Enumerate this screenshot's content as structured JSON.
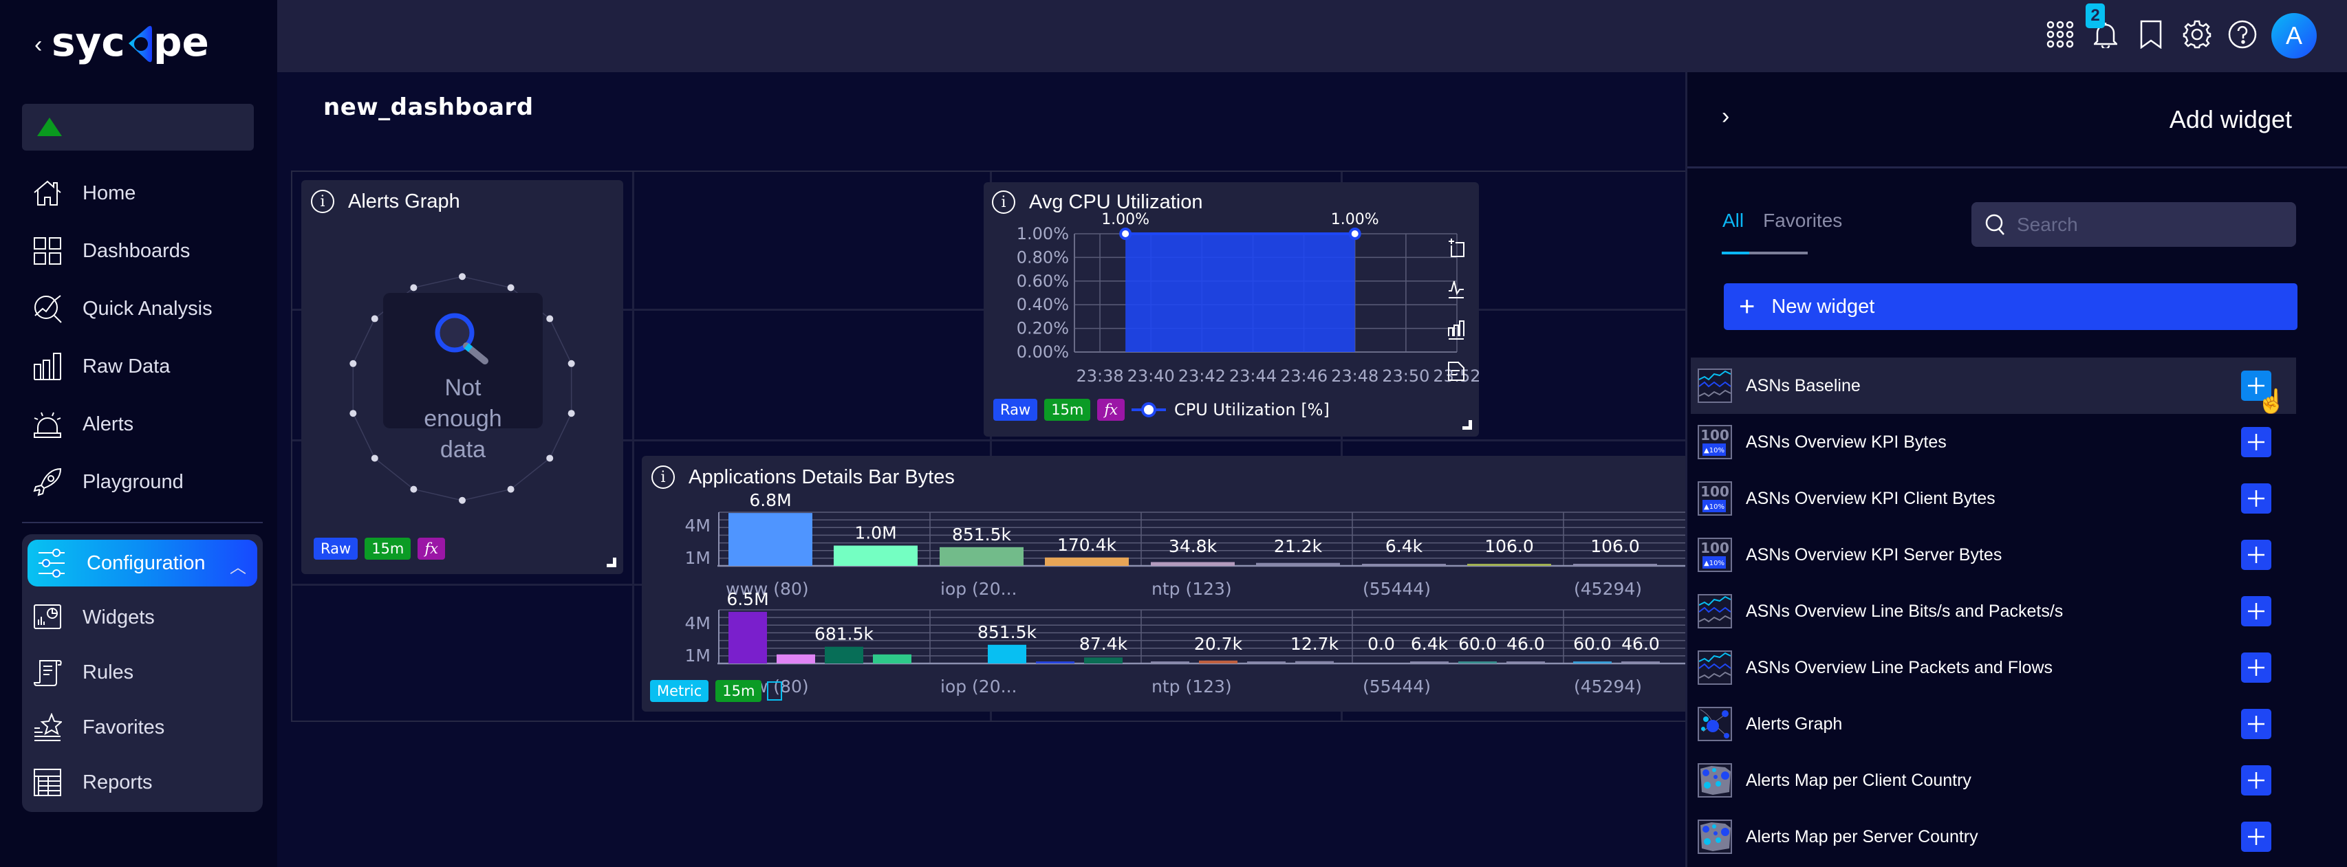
{
  "app": {
    "brand": "sycope",
    "back_icon": "chevron-left-icon"
  },
  "sidebar": {
    "status_icon": "green-triangle-icon",
    "items": [
      {
        "label": "Home",
        "icon": "home-icon"
      },
      {
        "label": "Dashboards",
        "icon": "dashboards-icon"
      },
      {
        "label": "Quick Analysis",
        "icon": "quick-analysis-icon"
      },
      {
        "label": "Raw Data",
        "icon": "bar-chart-icon"
      },
      {
        "label": "Alerts",
        "icon": "siren-icon"
      },
      {
        "label": "Playground",
        "icon": "rocket-icon"
      }
    ],
    "configuration": {
      "label": "Configuration",
      "icon": "sliders-icon",
      "expanded": true,
      "children": [
        {
          "label": "Widgets",
          "icon": "widgets-icon"
        },
        {
          "label": "Rules",
          "icon": "scroll-icon"
        },
        {
          "label": "Favorites",
          "icon": "star-list-icon"
        },
        {
          "label": "Reports",
          "icon": "table-icon"
        }
      ]
    }
  },
  "topbar": {
    "icons": [
      "apps-grid-icon",
      "bell-icon",
      "bookmark-icon",
      "gear-icon",
      "help-icon"
    ],
    "notification_count": "2",
    "avatar_initial": "A"
  },
  "dashboard": {
    "title": "new_dashboard",
    "widgets": {
      "alerts_graph": {
        "title": "Alerts Graph",
        "empty_message": "Not enough data",
        "tags": [
          "Raw",
          "15m",
          "fx"
        ]
      },
      "avg_cpu": {
        "title": "Avg CPU Utilization",
        "tags": [
          "Raw",
          "15m",
          "fx"
        ],
        "legend": "CPU Utilization [%]",
        "toolbar_icons": [
          "zoom-select-icon",
          "line-chart-icon",
          "bar-chart-icon",
          "export-icon"
        ]
      },
      "app_bar": {
        "title": "Applications Details Bar Bytes",
        "tags": [
          "Metric",
          "15m"
        ]
      }
    }
  },
  "chart_data": [
    {
      "type": "area",
      "title": "Avg CPU Utilization",
      "x": [
        "23:38",
        "23:40",
        "23:42",
        "23:44",
        "23:46",
        "23:48",
        "23:50",
        "23:52"
      ],
      "series": [
        {
          "name": "CPU Utilization [%]",
          "points": [
            [
              "23:39",
              1.0
            ],
            [
              "23:48",
              1.0
            ]
          ],
          "point_labels": [
            "1.00%",
            "1.00%"
          ],
          "color": "#1e47f5"
        }
      ],
      "yticks": [
        "0.00%",
        "0.20%",
        "0.40%",
        "0.60%",
        "0.80%",
        "1.00%"
      ],
      "ylim": [
        0,
        1.0
      ],
      "grid": true
    },
    {
      "type": "bar",
      "title": "Applications Details Bar Bytes (top)",
      "categories": [
        "www (80)",
        "iop (20...",
        "ntp (123)",
        "(55444)",
        "(45294)"
      ],
      "yticks": [
        "1M",
        "4M"
      ],
      "bars": [
        {
          "value": 6800000,
          "label": "6.8M",
          "color": "#4f95ff"
        },
        {
          "value": 1000000,
          "label": "1.0M",
          "color": "#74ffc2"
        },
        {
          "value": 851500,
          "label": "851.5k",
          "color": "#72bb8a"
        },
        {
          "value": 170400,
          "label": "170.4k",
          "color": "#e7a556"
        },
        {
          "value": 34800,
          "label": "34.8k",
          "color": "#b39bbd"
        },
        {
          "value": 21200,
          "label": "21.2k",
          "color": "#8888aa"
        },
        {
          "value": 6400,
          "label": "6.4k",
          "color": "#8888aa"
        },
        {
          "value": 106.0,
          "label": "106.0",
          "color": "#a0b050"
        },
        {
          "value": 106.0,
          "label": "106.0",
          "color": "#8888aa"
        }
      ],
      "ylim": [
        0,
        7000000
      ]
    },
    {
      "type": "bar",
      "title": "Applications Details Bar Bytes (bottom)",
      "categories": [
        "www (80)",
        "iop (20...",
        "ntp (123)",
        "(55444)",
        "(45294)"
      ],
      "yticks": [
        "1M",
        "4M"
      ],
      "bars": [
        {
          "value": 6500000,
          "label": "6.5M",
          "color": "#7a1fcc"
        },
        {
          "value": 200000,
          "label": "",
          "color": "#e084f5"
        },
        {
          "value": 681500,
          "label": "681.5k",
          "color": "#076e57"
        },
        {
          "value": 200000,
          "label": "",
          "color": "#2ec98a"
        },
        {
          "value": 0,
          "label": "",
          "color": "#8888aa"
        },
        {
          "value": 851500,
          "label": "851.5k",
          "color": "#08bff2"
        },
        {
          "value": 10000,
          "label": "",
          "color": "#2645e0"
        },
        {
          "value": 87400,
          "label": "87.4k",
          "color": "#0b6e55"
        },
        {
          "value": 10000,
          "label": "",
          "color": "#8888aa"
        },
        {
          "value": 20700,
          "label": "20.7k",
          "color": "#c06040"
        },
        {
          "value": 5000,
          "label": "",
          "color": "#8888aa"
        },
        {
          "value": 12700,
          "label": "12.7k",
          "color": "#8888aa"
        },
        {
          "value": 0.0,
          "label": "0.0",
          "color": "#8888aa"
        },
        {
          "value": 6400,
          "label": "6.4k",
          "color": "#8888aa"
        },
        {
          "value": 60.0,
          "label": "60.0",
          "color": "#3a8f8f"
        },
        {
          "value": 46.0,
          "label": "46.0",
          "color": "#8888aa"
        },
        {
          "value": 60.0,
          "label": "60.0",
          "color": "#3a9fd8"
        },
        {
          "value": 46.0,
          "label": "46.0",
          "color": "#8888aa"
        }
      ],
      "ylim": [
        0,
        7000000
      ]
    }
  ],
  "panel": {
    "title": "Add widget",
    "collapse_icon": "chevron-right-icon",
    "tabs": [
      {
        "label": "All",
        "active": true
      },
      {
        "label": "Favorites",
        "active": false
      }
    ],
    "search_placeholder": "Search",
    "new_widget_label": "New widget",
    "widgets": [
      {
        "label": "ASNs Baseline",
        "thumb": "line-thumb"
      },
      {
        "label": "ASNs Overview KPI Bytes",
        "thumb": "kpi-thumb"
      },
      {
        "label": "ASNs Overview KPI Client Bytes",
        "thumb": "kpi-thumb"
      },
      {
        "label": "ASNs Overview KPI Server Bytes",
        "thumb": "kpi-thumb"
      },
      {
        "label": "ASNs Overview Line Bits/s and Packets/s",
        "thumb": "line-thumb"
      },
      {
        "label": "ASNs Overview Line Packets and Flows",
        "thumb": "line-thumb"
      },
      {
        "label": "Alerts Graph",
        "thumb": "graph-thumb"
      },
      {
        "label": "Alerts Map per Client Country",
        "thumb": "map-thumb"
      },
      {
        "label": "Alerts Map per Server Country",
        "thumb": "map-thumb"
      }
    ],
    "kpi_thumb_text": "100",
    "kpi_thumb_badge": "▲10%"
  },
  "colors": {
    "accent": "#1e47f5",
    "cyan": "#08bff2",
    "green": "#0b9b25",
    "purple": "#9b16a6"
  }
}
